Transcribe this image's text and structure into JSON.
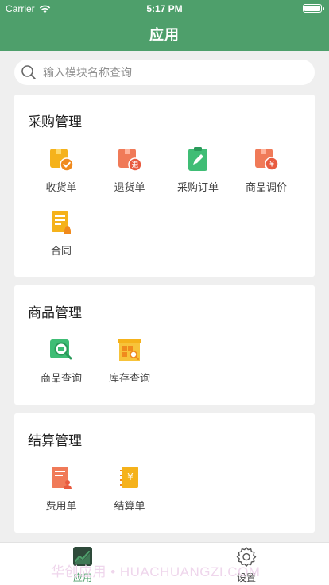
{
  "status_bar": {
    "carrier": "Carrier",
    "time": "5:17 PM"
  },
  "nav": {
    "title": "应用"
  },
  "search": {
    "placeholder": "输入模块名称查询"
  },
  "sections": [
    {
      "title": "采购管理",
      "items": [
        {
          "label": "收货单",
          "icon": "receipt-box-icon"
        },
        {
          "label": "退货单",
          "icon": "return-box-icon"
        },
        {
          "label": "采购订单",
          "icon": "clipboard-pen-icon"
        },
        {
          "label": "商品调价",
          "icon": "price-adjust-icon"
        },
        {
          "label": "合同",
          "icon": "contract-icon"
        }
      ]
    },
    {
      "title": "商品管理",
      "items": [
        {
          "label": "商品查询",
          "icon": "product-search-icon"
        },
        {
          "label": "库存查询",
          "icon": "warehouse-search-icon"
        }
      ]
    },
    {
      "title": "结算管理",
      "items": [
        {
          "label": "费用单",
          "icon": "expense-doc-icon"
        },
        {
          "label": "结算单",
          "icon": "settlement-doc-icon"
        }
      ]
    }
  ],
  "tabbar": [
    {
      "label": "应用",
      "icon": "chart-app-icon",
      "active": true
    },
    {
      "label": "设置",
      "icon": "gear-icon",
      "active": false
    }
  ],
  "watermark": "华创应用 • HUACHUANGZI.COM",
  "colors": {
    "brand": "#4e9f6b",
    "active_tab": "#4e9f6b"
  }
}
